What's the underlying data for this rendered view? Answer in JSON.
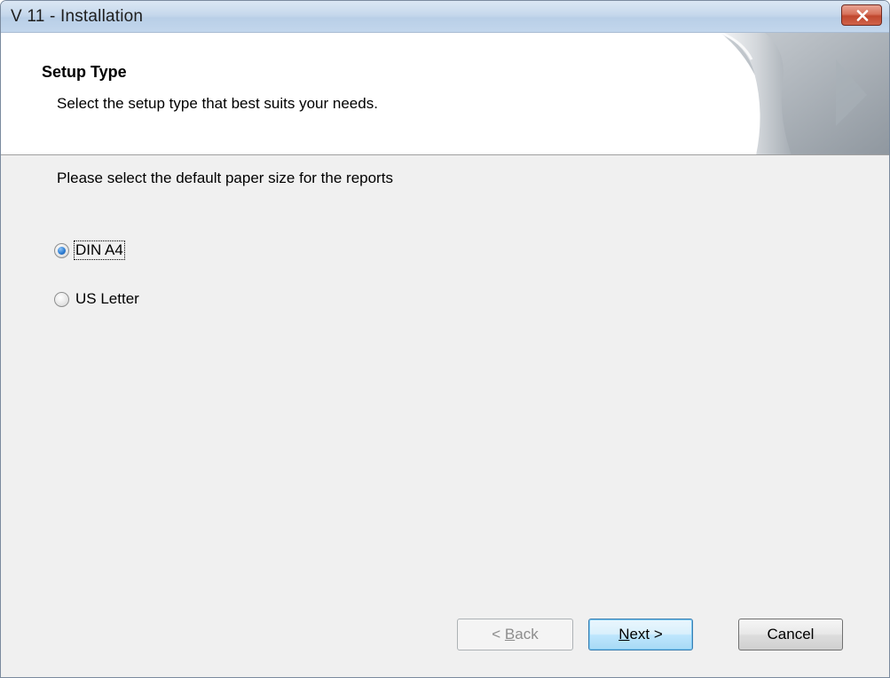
{
  "window": {
    "title": "V 11 - Installation"
  },
  "header": {
    "title": "Setup Type",
    "subtitle": "Select the setup type that best suits your needs."
  },
  "content": {
    "prompt": "Please select the default paper size for the reports",
    "options": [
      {
        "label": "DIN A4",
        "checked": true
      },
      {
        "label": "US Letter",
        "checked": false
      }
    ]
  },
  "buttons": {
    "back": {
      "prefix": "< ",
      "mnemonic": "B",
      "rest": "ack",
      "enabled": false
    },
    "next": {
      "mnemonic": "N",
      "rest": "ext >",
      "default": true
    },
    "cancel": {
      "label": "Cancel"
    }
  },
  "colors": {
    "close_button": "#c0472e",
    "title_bar": "#c6d8ec",
    "radio_selected": "#2f7fd4"
  },
  "icons": {
    "close": "close-icon",
    "header_graphic": "page-curl-graphic"
  }
}
